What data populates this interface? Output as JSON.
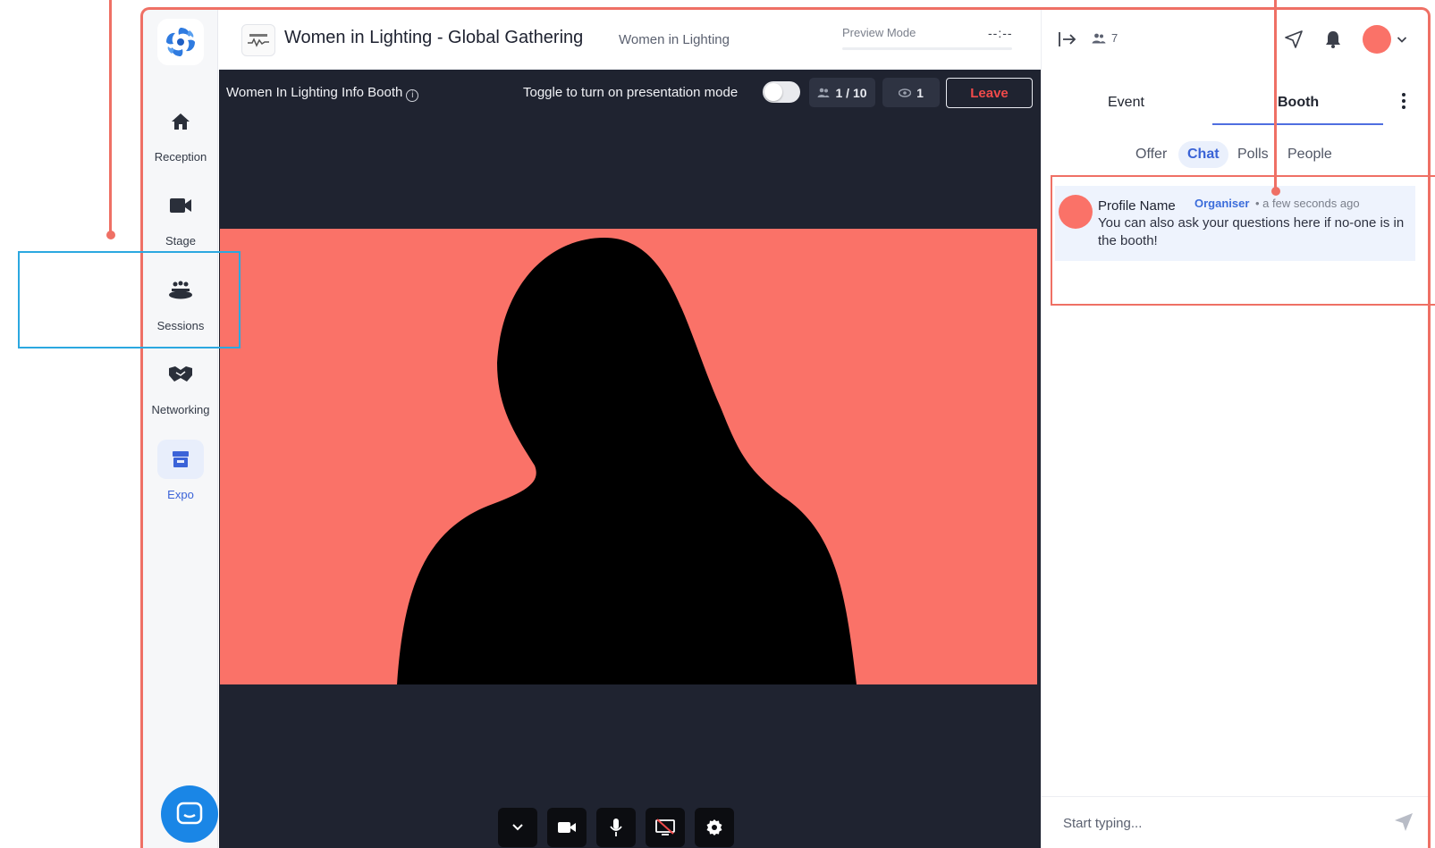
{
  "nav": {
    "items": [
      {
        "label": "Reception",
        "icon": "home-icon"
      },
      {
        "label": "Stage",
        "icon": "video-camera-icon"
      },
      {
        "label": "Sessions",
        "icon": "people-group-icon"
      },
      {
        "label": "Networking",
        "icon": "handshake-icon"
      },
      {
        "label": "Expo",
        "icon": "storefront-icon"
      }
    ],
    "active": "Expo"
  },
  "header": {
    "title": "Women in Lighting - Global Gathering",
    "organization": "Women in Lighting",
    "preview_mode": "Preview Mode",
    "timer": "--:--"
  },
  "booth": {
    "name": "Women In Lighting Info Booth",
    "toggle_label": "Toggle to turn on presentation mode",
    "capacity": "1 / 10",
    "viewers": "1",
    "leave_label": "Leave"
  },
  "panel": {
    "attendee_count": "7",
    "tabs": [
      "Event",
      "Booth"
    ],
    "active_tab": "Booth",
    "subtabs": [
      "Offer",
      "Chat",
      "Polls",
      "People"
    ],
    "active_subtab": "Chat",
    "message": {
      "name": "Profile Name",
      "role": "Organiser",
      "time": "• a few seconds ago",
      "text": "You can also ask your questions here if no-one is in the booth!"
    },
    "composer_placeholder": "Start typing..."
  },
  "colors": {
    "accent": "#fa7268",
    "annotation_red": "#ef7065",
    "annotation_blue": "#2ba8e0",
    "brand_blue": "#3b63d8"
  }
}
